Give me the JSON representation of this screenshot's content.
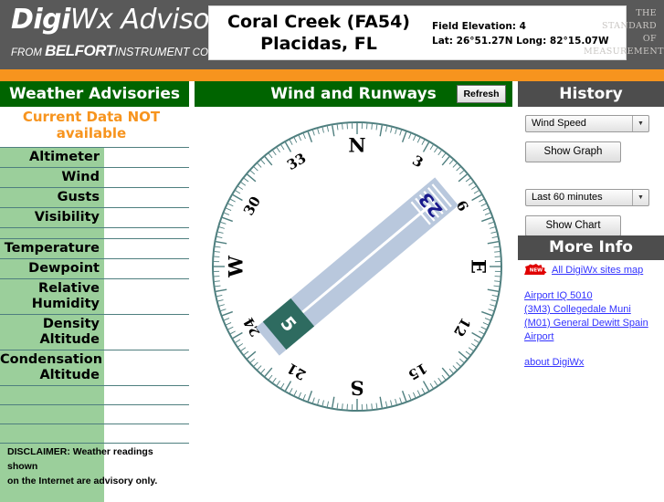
{
  "banner": {
    "logo_digi": "Digi",
    "logo_wx": "Wx",
    "logo_advisor": "Advisor",
    "logo_tm": "™",
    "logo_from": "FROM ",
    "logo_belfort": "BELFORT",
    "logo_instrument": "INSTRUMENT",
    "logo_company": " COMPANY",
    "site_name": "Coral Creek (FA54)",
    "site_sub": "Placidas, FL",
    "field_elevation": "Field Elevation: 4",
    "lat_long": "Lat: 26°51.27N  Long: 82°15.07W",
    "standard_line1": "THE",
    "standard_line2": "STANDARD",
    "standard_line3": "OF",
    "standard_line4": "MEASUREMENT"
  },
  "headers": {
    "left": "Weather Advisories",
    "middle": "Wind and Runways",
    "right": "History",
    "refresh_label": "Refresh"
  },
  "advisories": {
    "notice_line1": "Current Data  NOT",
    "notice_line2": "available",
    "rows": [
      {
        "label": "Altimeter",
        "value": ""
      },
      {
        "label": "Wind",
        "value": ""
      },
      {
        "label": "Gusts",
        "value": ""
      },
      {
        "label": "Visibility",
        "value": ""
      },
      {
        "label": "Temperature",
        "value": ""
      },
      {
        "label": "Dewpoint",
        "value": ""
      },
      {
        "label": "Relative\nHumidity",
        "value": ""
      },
      {
        "label": "Density\nAltitude",
        "value": ""
      },
      {
        "label": "Condensation\nAltitude",
        "value": ""
      }
    ],
    "disclaimer_line1": "DISCLAIMER: Weather readings shown",
    "disclaimer_line2": "on the Internet are advisory only."
  },
  "history": {
    "parameter_selected": "Wind Speed",
    "show_graph_label": "Show Graph",
    "range_selected": "Last 60 minutes",
    "show_chart_label": "Show Chart",
    "dropdown_arrow": "▼"
  },
  "more_info": {
    "title": "More Info",
    "new_badge": "NEW",
    "sites_map": "All DigiWx sites map",
    "link1": "Airport IQ 5010",
    "link2": "(3M3) Collegedale Muni",
    "link3": "(M01) General Dewitt Spain",
    "link4": "Airport",
    "link5": "about DigiWx"
  },
  "compass": {
    "cardinals": [
      "N",
      "E",
      "S",
      "W"
    ],
    "numbers": [
      "3",
      "6",
      "12",
      "15",
      "21",
      "24",
      "30",
      "33"
    ],
    "runway_end_a": "23",
    "runway_end_b": "5",
    "runway_heading_deg": 50,
    "dial_color": "#4f7f7f",
    "runway_color": "#b9c8dd",
    "runway_marker_color": "#2e6b60",
    "label_color": "#1a1a8c"
  }
}
